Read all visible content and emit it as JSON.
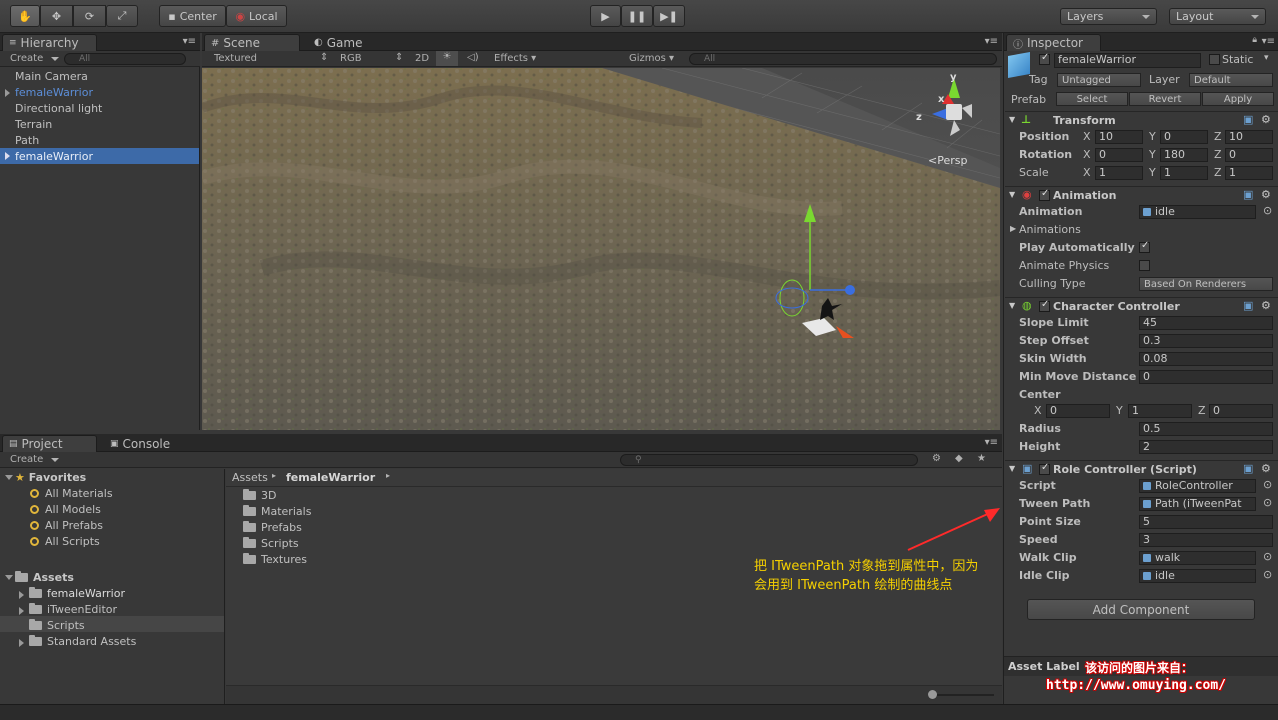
{
  "toolbar": {
    "center": "Center",
    "local": "Local",
    "layers": "Layers",
    "layout": "Layout"
  },
  "hierarchy": {
    "tab": "Hierarchy",
    "create": "Create",
    "search_placeholder": "All",
    "items": [
      {
        "label": "Main Camera"
      },
      {
        "label": "femaleWarrior"
      },
      {
        "label": "Directional light"
      },
      {
        "label": "Terrain"
      },
      {
        "label": "Path"
      },
      {
        "label": "femaleWarrior"
      }
    ]
  },
  "scene": {
    "tab_scene": "Scene",
    "tab_game": "Game",
    "textured": "Textured",
    "rgb": "RGB",
    "mode2d": "2D",
    "effects": "Effects",
    "gizmos": "Gizmos",
    "search_placeholder": "All",
    "persp": "Persp",
    "axis_y": "y",
    "axis_x": "x",
    "axis_z": "z"
  },
  "project": {
    "tab_project": "Project",
    "tab_console": "Console",
    "create": "Create",
    "favorites_label": "Favorites",
    "favorites": [
      "All Materials",
      "All Models",
      "All Prefabs",
      "All Scripts"
    ],
    "assets_label": "Assets",
    "assets_tree": [
      "femaleWarrior",
      "iTweenEditor",
      "Scripts",
      "Standard Assets"
    ],
    "breadcrumb_root": "Assets",
    "breadcrumb_current": "femaleWarrior",
    "folders": [
      "3D",
      "Materials",
      "Prefabs",
      "Scripts",
      "Textures"
    ]
  },
  "inspector": {
    "tab": "Inspector",
    "object_name": "femaleWarrior",
    "static": "Static",
    "tag_label": "Tag",
    "tag_value": "Untagged",
    "layer_label": "Layer",
    "layer_value": "Default",
    "prefab_label": "Prefab",
    "select": "Select",
    "revert": "Revert",
    "apply": "Apply",
    "transform": {
      "title": "Transform",
      "position": "Position",
      "rotation": "Rotation",
      "scale": "Scale",
      "x": "X",
      "y": "Y",
      "z": "Z",
      "pos": [
        "10",
        "0",
        "10"
      ],
      "rot": [
        "0",
        "180",
        "0"
      ],
      "scl": [
        "1",
        "1",
        "1"
      ]
    },
    "animation": {
      "title": "Animation",
      "animation_label": "Animation",
      "animation_value": "idle",
      "animations": "Animations",
      "play_auto": "Play Automatically",
      "animate_physics": "Animate Physics",
      "culling": "Culling Type",
      "culling_value": "Based On Renderers"
    },
    "cc": {
      "title": "Character Controller",
      "slope": "Slope Limit",
      "slope_v": "45",
      "step": "Step Offset",
      "step_v": "0.3",
      "skin": "Skin Width",
      "skin_v": "0.08",
      "minmove": "Min Move Distance",
      "minmove_v": "0",
      "center": "Center",
      "cx": "0",
      "cy": "1",
      "cz": "0",
      "radius": "Radius",
      "radius_v": "0.5",
      "height": "Height",
      "height_v": "2"
    },
    "rc": {
      "title": "Role Controller (Script)",
      "script": "Script",
      "script_v": "RoleController",
      "tween": "Tween Path",
      "tween_v": "Path (iTweenPat",
      "point": "Point Size",
      "point_v": "5",
      "speed": "Speed",
      "speed_v": "3",
      "walk": "Walk Clip",
      "walk_v": "walk",
      "idle": "Idle Clip",
      "idle_v": "idle"
    },
    "add_component": "Add Component",
    "asset_labels": "Asset Label"
  },
  "annotation": {
    "line1": "把 ITweenPath 对象拖到属性中，因为",
    "line2": "会用到 ITweenPath 绘制的曲线点"
  },
  "watermark": {
    "line1": "该访问的图片来自：",
    "line2": "http://www.omuying.com/"
  },
  "colors": {
    "selection": "#3d6aa8",
    "accent_note": "#f5d000",
    "arrow": "#ff2a2a"
  }
}
